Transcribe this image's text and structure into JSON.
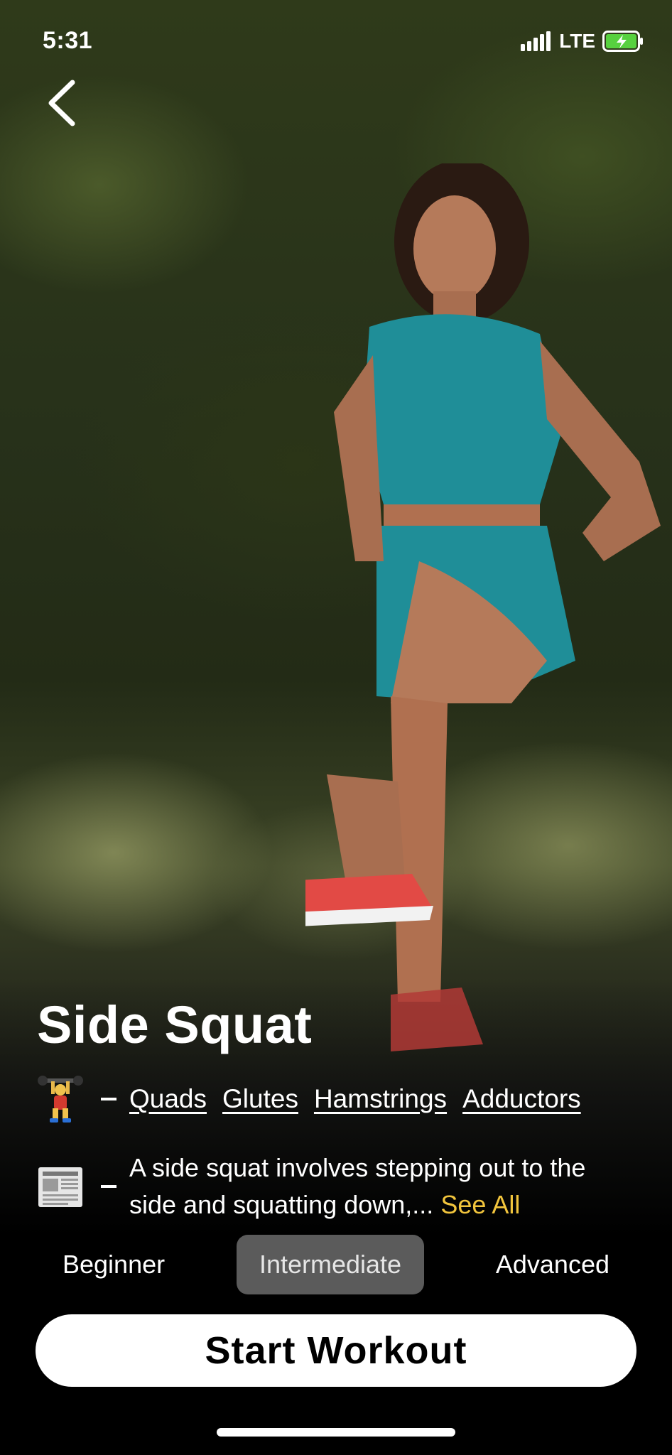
{
  "status_bar": {
    "time": "5:31",
    "network": "LTE"
  },
  "exercise": {
    "title": "Side Squat",
    "muscles": [
      "Quads",
      "Glutes",
      "Hamstrings",
      "Adductors"
    ],
    "description": "A side squat involves stepping out to the side and squatting down,...",
    "see_all_label": "See All"
  },
  "levels": {
    "items": [
      "Beginner",
      "Intermediate",
      "Advanced"
    ],
    "selected": "Intermediate"
  },
  "start_button_label": "Start Workout",
  "colors": {
    "accent": "#f2c53d",
    "selected_level_bg": "#5b5b5b",
    "button_bg": "#ffffff"
  },
  "icons": {
    "muscles": "weightlifter-emoji-icon",
    "description": "newspaper-emoji-icon",
    "back": "chevron-left-icon"
  }
}
